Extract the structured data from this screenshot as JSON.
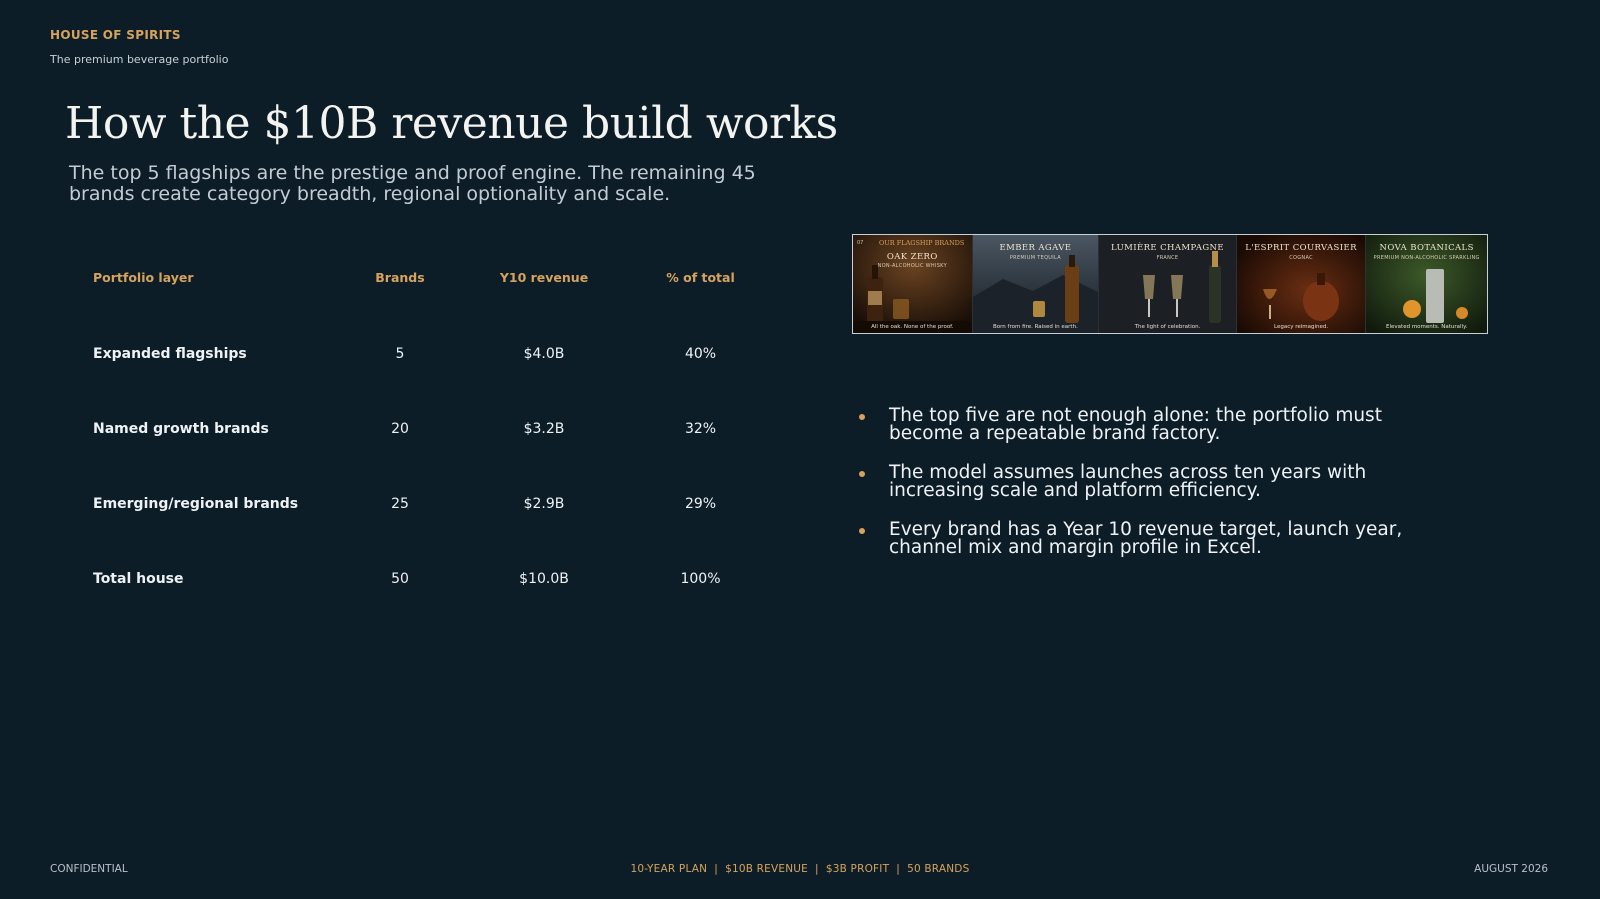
{
  "header": {
    "brand": "HOUSE OF SPIRITS",
    "tagline": "The premium beverage portfolio"
  },
  "title": "How the $10B revenue build works",
  "subtitle": "The top 5 flagships are the prestige and proof engine. The remaining 45 brands create category breadth, regional optionality and scale.",
  "table": {
    "headers": [
      "Portfolio layer",
      "Brands",
      "Y10 revenue",
      "% of total"
    ],
    "rows": [
      [
        "Expanded flagships",
        "5",
        "$4.0B",
        "40%"
      ],
      [
        "Named growth brands",
        "20",
        "$3.2B",
        "32%"
      ],
      [
        "Emerging/regional brands",
        "25",
        "$2.9B",
        "29%"
      ],
      [
        "Total house",
        "50",
        "$10.0B",
        "100%"
      ]
    ]
  },
  "brand_strip": {
    "number": "07",
    "label": "OUR FLAGSHIP BRANDS",
    "panels": [
      {
        "name": "OAK ZERO",
        "sub": "NON-ALCOHOLIC WHISKY",
        "tagline": "All the oak. None of the proof.",
        "bg": "#2a1b10",
        "accent": "#6b4321"
      },
      {
        "name": "EMBER AGAVE",
        "sub": "PREMIUM TEQUILA",
        "tagline": "Born from fire. Raised in earth.",
        "bg": "#3a4650",
        "accent": "#1a2430"
      },
      {
        "name": "LUMIÈRE CHAMPAGNE",
        "sub": "FRANCE",
        "tagline": "The light of celebration.",
        "bg": "#1f2126",
        "accent": "#3a3a34"
      },
      {
        "name": "L'ESPRIT COURVASIER",
        "sub": "COGNAC",
        "tagline": "Legacy reimagined.",
        "bg": "#2a140a",
        "accent": "#5e2a12"
      },
      {
        "name": "NOVA BOTANICALS",
        "sub": "PREMIUM NON-ALCOHOLIC SPARKLING",
        "tagline": "Elevated moments. Naturally.",
        "bg": "#1b2a16",
        "accent": "#3b4d2a"
      }
    ]
  },
  "bullets": [
    "The top five are not enough alone: the portfolio must become a repeatable brand factory.",
    "The model assumes launches across ten years with increasing scale and platform efficiency.",
    "Every brand has a Year 10 revenue target, launch year, channel mix and margin profile in Excel."
  ],
  "footer": {
    "left": "CONFIDENTIAL",
    "center": "10-YEAR PLAN  |  $10B REVENUE  |  $3B PROFIT  |  50 BRANDS",
    "right": "AUGUST 2026"
  },
  "colors": {
    "background": "#0d1d28",
    "accent": "#d6a35d"
  }
}
